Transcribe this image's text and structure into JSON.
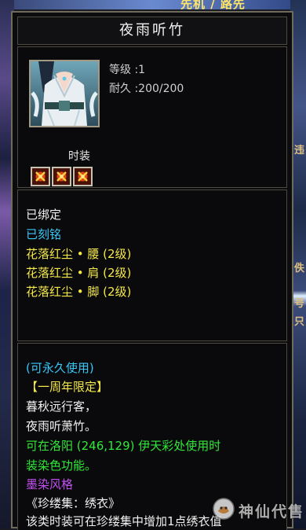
{
  "background": {
    "top_text": "先机 / 路先",
    "right_glyphs": [
      "违",
      "佚",
      "号",
      "只"
    ]
  },
  "tooltip": {
    "title": "夜雨听竹",
    "item_icon": "costume-portrait-icon",
    "stats": {
      "level": "等级 :1",
      "durability": "耐久 :200/200"
    },
    "slot_label": "时装",
    "slots": [
      {
        "icon": "red-gem-slot-icon"
      },
      {
        "icon": "red-gem-slot-icon"
      },
      {
        "icon": "red-gem-slot-icon"
      }
    ],
    "binding": {
      "bound": "已绑定",
      "engraved": "已刻铭",
      "set_lines": [
        "花落红尘 • 腰 (2级)",
        "花落红尘 • 肩 (2级)",
        "花落红尘 • 脚 (2级)"
      ]
    },
    "description": {
      "permanent": "(可永久使用)",
      "limited": "【一周年限定】",
      "poem_1": "暮秋远行客，",
      "poem_2": "夜雨听萧竹。",
      "dye_1": "可在洛阳 (246,129) 伊天彩处使用时",
      "dye_2": "装染色功能。",
      "style": "墨染风格",
      "collection": "《珍缕集：绣衣》",
      "collection_note": "该类时装可在珍缕集中增加1点绣衣值"
    },
    "watermark": "神仙代售"
  },
  "colors": {
    "cyan": "#38c8f8",
    "yellow": "#f4e84a",
    "green": "#30e838",
    "purple": "#c050f0"
  }
}
